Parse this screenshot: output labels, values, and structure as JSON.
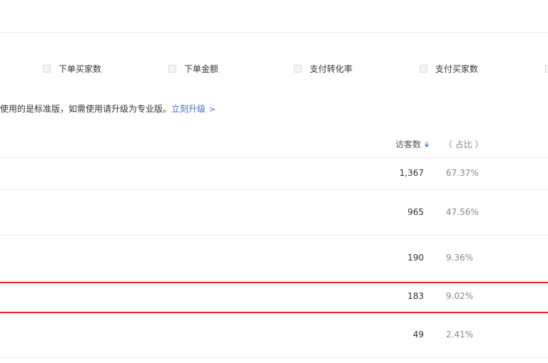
{
  "metrics": [
    {
      "label": "下单买家数",
      "checked": false
    },
    {
      "label": "下单金额",
      "checked": false
    },
    {
      "label": "支付转化率",
      "checked": false
    },
    {
      "label": "支付买家数",
      "checked": false
    }
  ],
  "notice": {
    "text": "使用的是标准版，如需使用请升级为专业版。",
    "link_label": "立刻升级",
    "link_chevron": ">"
  },
  "table": {
    "headers": {
      "visitors": "访客数",
      "share": "（ 占比 ）"
    },
    "rows": [
      {
        "visitors": "1,367",
        "share": "67.37%"
      },
      {
        "visitors": "965",
        "share": "47.56%"
      },
      {
        "visitors": "190",
        "share": "9.36%"
      },
      {
        "visitors": "183",
        "share": "9.02%"
      },
      {
        "visitors": "49",
        "share": "2.41%"
      }
    ]
  },
  "colors": {
    "highlight": "#e8272d",
    "link": "#3f6fd8"
  }
}
